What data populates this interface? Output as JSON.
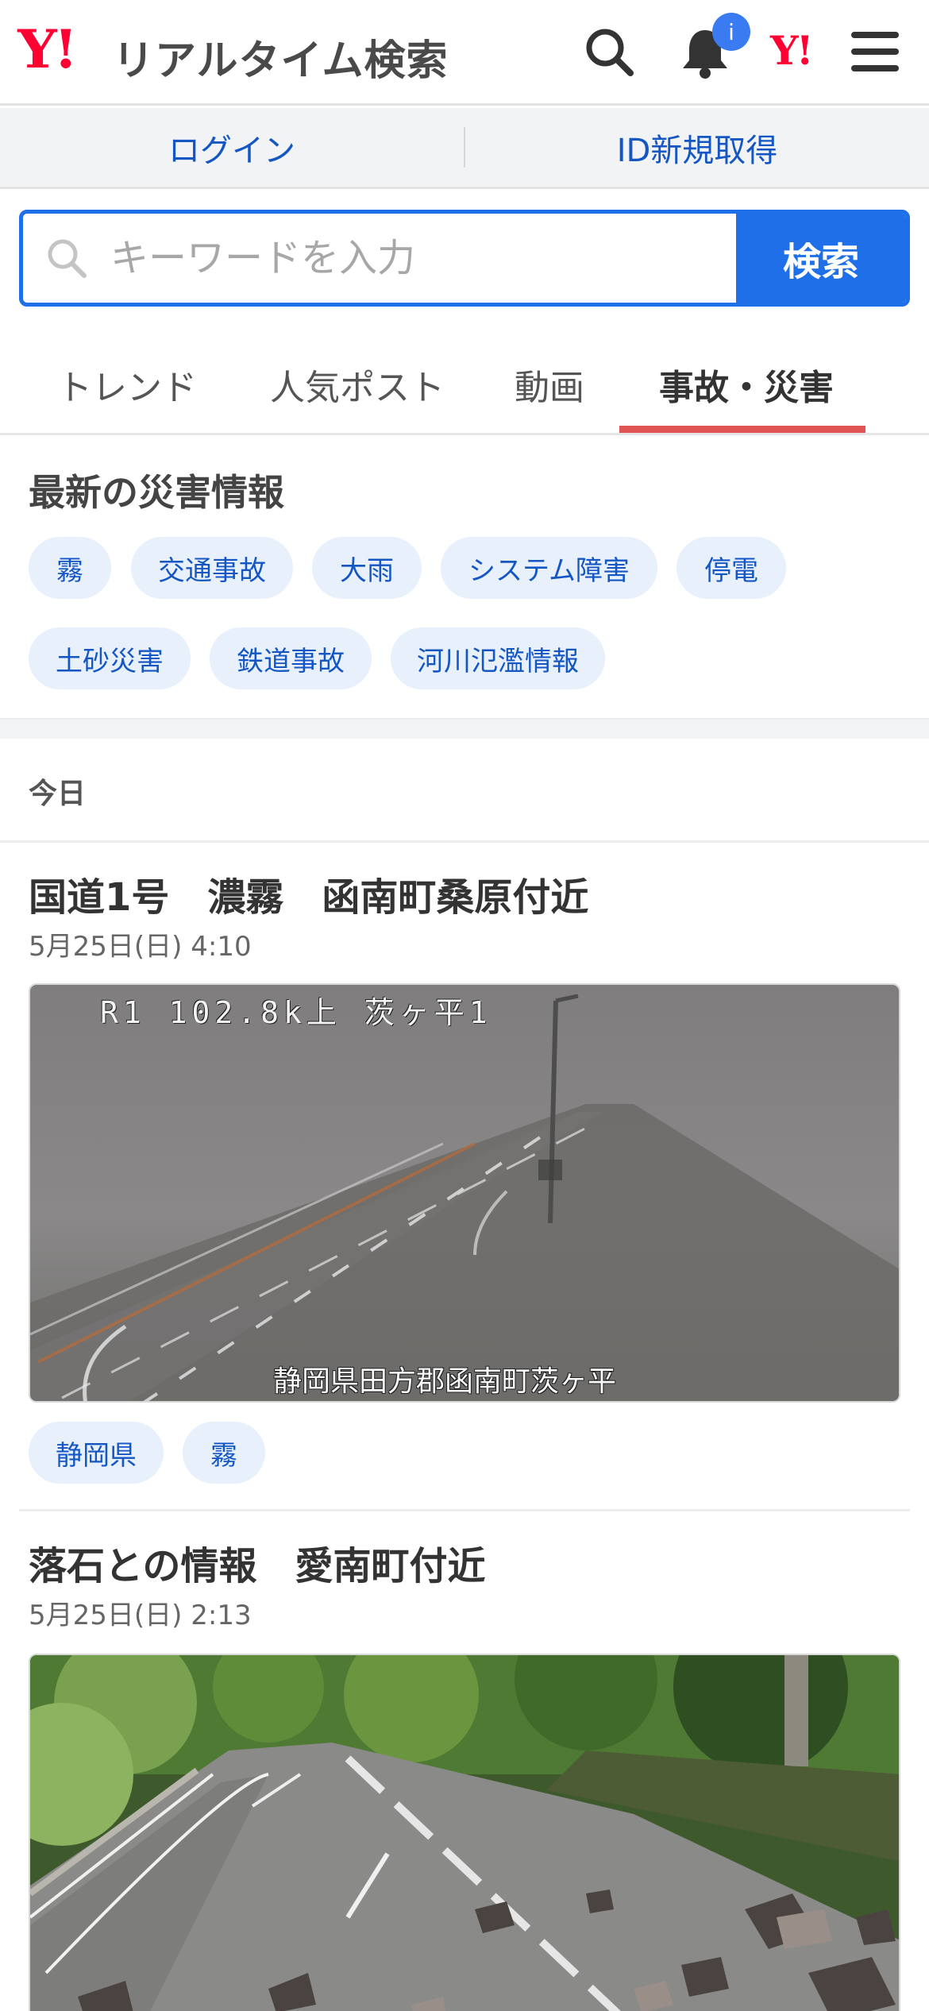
{
  "header": {
    "logo_mark": "Y!",
    "logo_text": "リアルタイム検索",
    "icons": [
      "search-icon",
      "bell-icon",
      "yahoo-logo-icon",
      "menu-icon"
    ],
    "notification_badge": "i",
    "yahoo_mark": "Y!"
  },
  "account_bar": {
    "login": "ログイン",
    "signup": "ID新規取得"
  },
  "search": {
    "placeholder": "キーワードを入力",
    "button": "検索"
  },
  "tabs": [
    {
      "label": "トレンド",
      "active": false
    },
    {
      "label": "人気ポスト",
      "active": false
    },
    {
      "label": "動画",
      "active": false
    },
    {
      "label": "事故・災害",
      "active": true
    }
  ],
  "disaster_info": {
    "title": "最新の災害情報",
    "tags": [
      "霧",
      "交通事故",
      "大雨",
      "システム障害",
      "停電",
      "土砂災害",
      "鉄道事故",
      "河川氾濫情報"
    ]
  },
  "feed": {
    "date_header": "今日",
    "posts": [
      {
        "title": "国道1号　濃霧　函南町桑原付近",
        "time": "5月25日(日) 4:10",
        "image_caption_top": "R1 102.8k上 茨ヶ平1",
        "image_caption_bottom": "静岡県田方郡函南町茨ヶ平",
        "tags": [
          "静岡県",
          "霧"
        ]
      },
      {
        "title": "落石との情報　愛南町付近",
        "time": "5月25日(日) 2:13"
      }
    ]
  },
  "colors": {
    "brand_red": "#ff0033",
    "link_blue": "#1456c4",
    "search_blue": "#1e6fe8",
    "tab_active_underline": "#e05454",
    "chip_bg": "#e7f0fb"
  }
}
